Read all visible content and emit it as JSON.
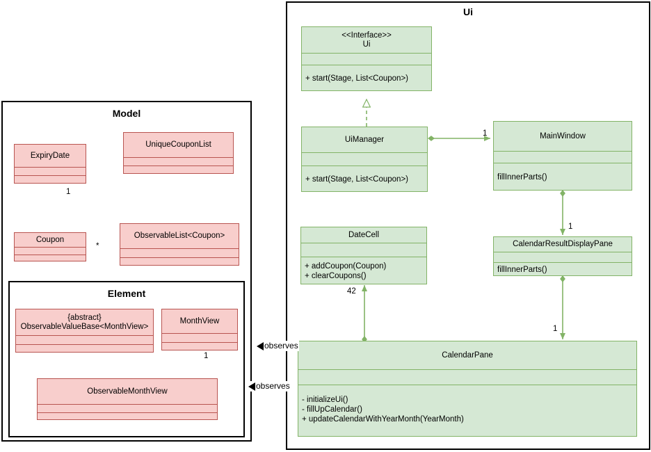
{
  "diagram": {
    "type": "uml-class-diagram",
    "background": "#ffffff",
    "green_fill": "#d5e8d4",
    "green_stroke": "#82b366",
    "pink_fill": "#f8cecc",
    "pink_stroke": "#b85450"
  },
  "packages": {
    "ui": {
      "title": "Ui"
    },
    "model": {
      "title": "Model"
    },
    "element": {
      "title": "Element"
    }
  },
  "classes": {
    "ui_interface": {
      "name": "<<Interface>>\nUi",
      "stereotype": "<<Interface>>",
      "short_name": "Ui",
      "attributes": "",
      "methods": "+ start(Stage, List<Coupon>)"
    },
    "ui_manager": {
      "name": "UiManager",
      "attributes": "",
      "methods": "+ start(Stage, List<Coupon>)"
    },
    "main_window": {
      "name": "MainWindow",
      "attributes": "",
      "methods": "fillInnerParts()"
    },
    "date_cell": {
      "name": "DateCell",
      "attributes": "",
      "methods": "+ addCoupon(Coupon)\n+ clearCoupons()"
    },
    "calendar_result_display_pane": {
      "name": "CalendarResultDisplayPane",
      "attributes": "",
      "methods": "fillInnerParts()"
    },
    "calendar_pane": {
      "name": "CalendarPane",
      "attributes": "",
      "methods": "- initializeUi()\n- fillUpCalendar()\n+ updateCalendarWithYearMonth(YearMonth)"
    },
    "expiry_date": {
      "name": "ExpiryDate",
      "attributes": "",
      "methods": ""
    },
    "unique_coupon_list": {
      "name": "UniqueCouponList",
      "attributes": "",
      "methods": ""
    },
    "coupon": {
      "name": "Coupon",
      "attributes": "",
      "methods": ""
    },
    "observable_list_coupon": {
      "name": "ObservableList<Coupon>",
      "attributes": "",
      "methods": ""
    },
    "observable_value_base": {
      "name": "{abstract}\nObservableValueBase<MonthView>",
      "stereotype": "{abstract}",
      "short_name": "ObservableValueBase<MonthView>",
      "attributes": "",
      "methods": ""
    },
    "month_view": {
      "name": "MonthView",
      "attributes": "",
      "methods": ""
    },
    "observable_month_view": {
      "name": "ObservableMonthView",
      "attributes": "",
      "methods": ""
    }
  },
  "edge_labels": {
    "ui_manager_main_window": "1",
    "main_window_calendar_result": "1",
    "calendar_result_calendar_pane": "1",
    "calendar_pane_date_cell": "42",
    "expiry_date_coupon": "1",
    "coupon_observable_list": "*",
    "month_view_observable_month_view": "1",
    "observes_calendar_pane_list": "observes",
    "observes_calendar_pane_month_view": "observes"
  }
}
